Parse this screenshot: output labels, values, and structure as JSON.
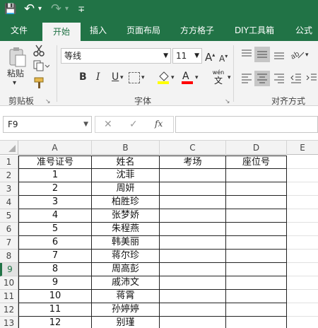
{
  "qat": {
    "save": "💾",
    "undo": "↶",
    "undo_dd": "▾",
    "redo": "↷",
    "redo_dd": "▾",
    "customize": "∓"
  },
  "tabs": [
    "文件",
    "开始",
    "插入",
    "页面布局",
    "方方格子",
    "DIY工具箱",
    "公式"
  ],
  "ribbon": {
    "clipboard": {
      "label": "剪贴板",
      "paste": "粘贴",
      "paste_dd": "▾",
      "launcher": "↘"
    },
    "font": {
      "label": "字体",
      "name": "等线",
      "size": "11",
      "bold": "B",
      "italic": "I",
      "underline": "U",
      "grow": "A",
      "shrink": "A",
      "font_color": "A",
      "wen": "wén",
      "zi": "文",
      "launcher": "↘"
    },
    "alignment": {
      "label": "对齐方式"
    }
  },
  "formula_bar": {
    "name_box": "F9",
    "cancel": "✕",
    "enter": "✓",
    "fx": "fx",
    "formula": ""
  },
  "columns": [
    "A",
    "B",
    "C",
    "D",
    "E"
  ],
  "rows": [
    {
      "n": "1",
      "a": "准号证号",
      "b": "姓名",
      "c": "考场",
      "d": "座位号"
    },
    {
      "n": "2",
      "a": "1",
      "b": "沈菲",
      "c": "",
      "d": ""
    },
    {
      "n": "3",
      "a": "2",
      "b": "周妍",
      "c": "",
      "d": ""
    },
    {
      "n": "4",
      "a": "3",
      "b": "柏胜珍",
      "c": "",
      "d": ""
    },
    {
      "n": "5",
      "a": "4",
      "b": "张梦娇",
      "c": "",
      "d": ""
    },
    {
      "n": "6",
      "a": "5",
      "b": "朱程燕",
      "c": "",
      "d": ""
    },
    {
      "n": "7",
      "a": "6",
      "b": "韩美丽",
      "c": "",
      "d": ""
    },
    {
      "n": "8",
      "a": "7",
      "b": "蒋尔珍",
      "c": "",
      "d": ""
    },
    {
      "n": "9",
      "a": "8",
      "b": "周高彭",
      "c": "",
      "d": ""
    },
    {
      "n": "10",
      "a": "9",
      "b": "戚沛文",
      "c": "",
      "d": ""
    },
    {
      "n": "11",
      "a": "10",
      "b": "蒋霄",
      "c": "",
      "d": ""
    },
    {
      "n": "12",
      "a": "11",
      "b": "孙婷婷",
      "c": "",
      "d": ""
    },
    {
      "n": "13",
      "a": "12",
      "b": "别瑾",
      "c": "",
      "d": ""
    }
  ],
  "colors": {
    "brand": "#217346",
    "ribbon": "#f3f3f3",
    "selected_row_header": "#217346"
  }
}
